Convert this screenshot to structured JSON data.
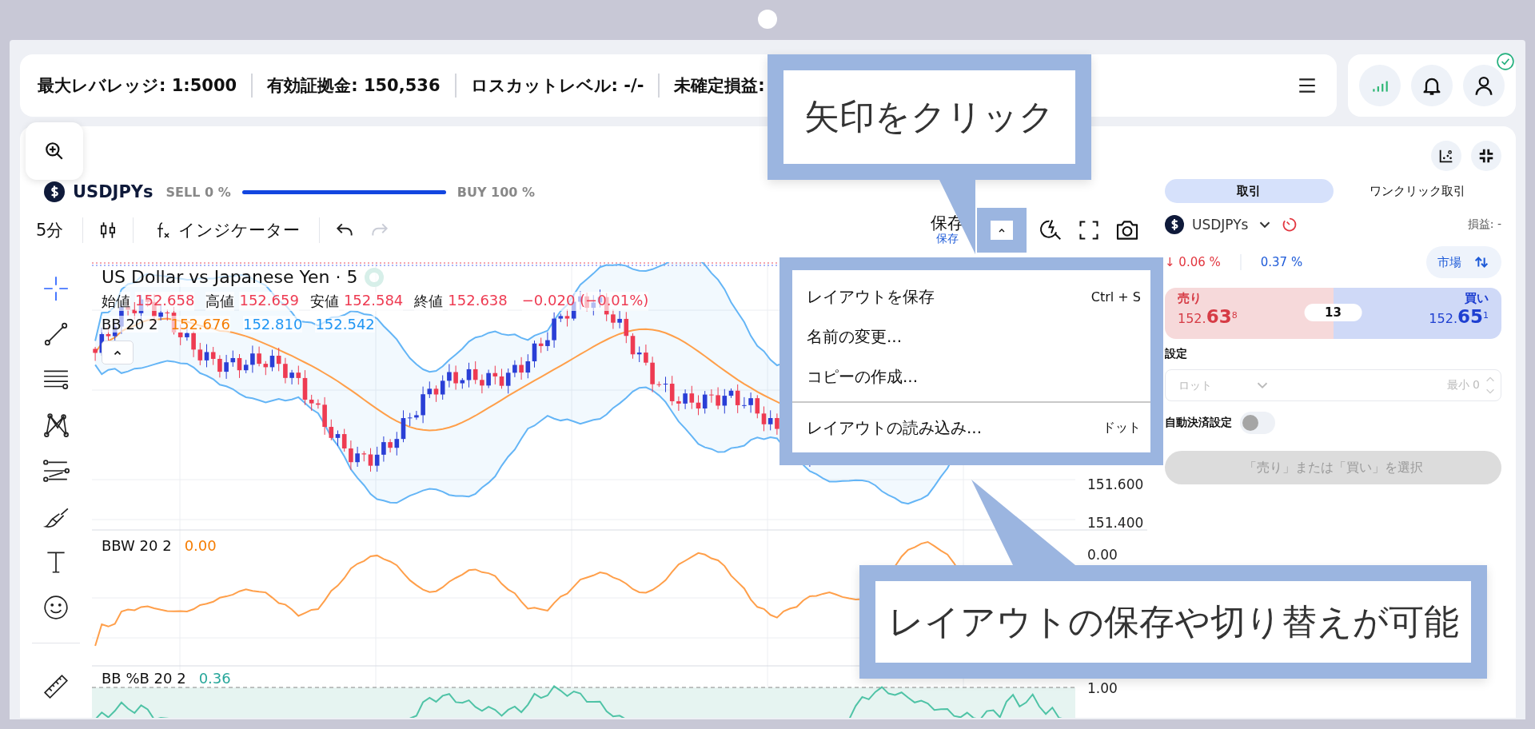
{
  "account_bar": {
    "stats": [
      "最大レバレッジ: 1:5000",
      "有効証拠金: 150,536",
      "ロスカットレベル: -/-",
      "未確定損益:"
    ],
    "verified": true
  },
  "symbol_bar": {
    "symbol": "USDJPYs",
    "sell": "SELL 0 %",
    "buy": "BUY 100 %",
    "level": 1
  },
  "toolbar": {
    "interval": "5分",
    "indicators": "インジケーター",
    "redo_disabled": true,
    "save_title": "保存",
    "save_status": "保存"
  },
  "tool_groups": [
    [
      {
        "kind": "crosshair",
        "selected": true
      },
      {
        "kind": "trend-line",
        "selected": false
      },
      {
        "kind": "fib",
        "selected": false
      },
      {
        "kind": "pattern",
        "selected": false
      },
      {
        "kind": "forecast",
        "selected": false
      },
      {
        "kind": "brush",
        "selected": false
      },
      {
        "kind": "text",
        "selected": false
      },
      {
        "kind": "emoji",
        "selected": false
      }
    ],
    [
      {
        "kind": "ruler",
        "selected": false
      }
    ]
  ],
  "legend": {
    "title": "US Dollar vs Japanese Yen · 5",
    "ohlc": [
      {
        "label": "始値",
        "value": "152.658"
      },
      {
        "label": "高値",
        "value": "152.659"
      },
      {
        "label": "安値",
        "value": "152.584"
      },
      {
        "label": "終値",
        "value": "152.638"
      }
    ],
    "change": "−0.020 (−0.01%)",
    "bb": {
      "label": "BB 20 2",
      "values": [
        {
          "value": "152.676",
          "color": "#f57c00"
        },
        {
          "value": "152.810",
          "color": "#2196f3"
        },
        {
          "value": "152.542",
          "color": "#2196f3"
        }
      ]
    },
    "bbw": {
      "label": "BBW 20 2",
      "value": "0.00"
    },
    "pb": {
      "label": "BB %B 20 2",
      "value": "0.36"
    }
  },
  "price_axis": [
    "151.600",
    "151.400"
  ],
  "bbw_axis": [
    "0.00"
  ],
  "pb_axis": [
    "1.00"
  ],
  "menu": {
    "groups": [
      [
        {
          "label": "レイアウトを保存",
          "shortcut": "Ctrl + S"
        },
        {
          "label": "名前の変更..."
        },
        {
          "label": "コピーの作成..."
        }
      ],
      [
        {
          "label": "レイアウトの読み込み...",
          "shortcut": "ドット"
        }
      ]
    ]
  },
  "callouts": [
    {
      "text": "矢印をクリック"
    },
    {
      "text": "レイアウトの保存や切り替えが可能"
    }
  ],
  "trade_panel": {
    "tabs": [
      {
        "label": "取引",
        "selected": true
      },
      {
        "label": "ワンクリック取引",
        "selected": false
      }
    ],
    "symbol": "USDJPYs",
    "pnl": "損益: -",
    "change": "↓ 0.06 %",
    "spread_pct": "0.37 %",
    "order_type": "市場",
    "sell": {
      "label": "売り",
      "price": "152.**63**$^{8}$"
    },
    "spread": "13",
    "buy": {
      "label": "買い",
      "price": "152.**65**$^{1}$"
    },
    "settings_label": "設定",
    "lot": {
      "placeholder": "ロット",
      "min": "最小 0"
    },
    "auto_close": {
      "label": "自動決済設定",
      "on": false
    },
    "submit": {
      "label": "「売り」または「買い」を選択",
      "disabled": true
    }
  }
}
